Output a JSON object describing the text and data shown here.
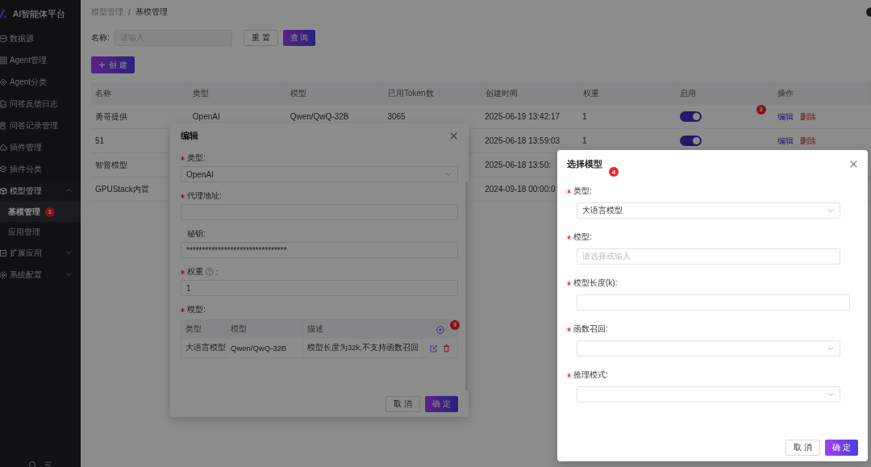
{
  "sidebar": {
    "logo": "AI智能体平台",
    "items": [
      {
        "label": "数据源"
      },
      {
        "label": "Agent管理"
      },
      {
        "label": "Agent分类"
      },
      {
        "label": "问答反馈日志"
      },
      {
        "label": "问答记录管理"
      },
      {
        "label": "插件管理"
      },
      {
        "label": "插件分类"
      },
      {
        "label": "模型管理",
        "expanded": true,
        "children": [
          {
            "label": "基模管理",
            "selected": true,
            "badge": "1"
          },
          {
            "label": "应用管理",
            "selected": false
          }
        ]
      },
      {
        "label": "扩展应用",
        "expanded": false
      },
      {
        "label": "系统配置",
        "expanded": false
      }
    ]
  },
  "breadcrumb": {
    "items": [
      "模型管理",
      "基模管理"
    ],
    "separator": "/"
  },
  "filter": {
    "label": "名称:",
    "placeholder": "请输入",
    "buttons": [
      {
        "label": "重 置",
        "kind": "default"
      },
      {
        "label": "查 询",
        "kind": "primary"
      }
    ]
  },
  "create_button": {
    "label": "创 建"
  },
  "table": {
    "columns": [
      "名称",
      "类型",
      "模型",
      "已用Token数",
      "创建时间",
      "权重",
      "启用",
      "操作"
    ],
    "rows": [
      {
        "name": "勇哥提供",
        "type": "OpenAI",
        "model": "Qwen/QwQ-32B",
        "tokens": "3065",
        "created": "2025-06-19 13:42:17",
        "weight": "1",
        "enabled": true,
        "actions": [
          "编辑",
          "删除"
        ],
        "badge": "2"
      },
      {
        "name": "51",
        "created": "2025-06-18 13:59:03",
        "weight": "1",
        "enabled": true,
        "actions": [
          "编辑",
          "删除"
        ]
      },
      {
        "name": "智普模型",
        "created": "2025-06-18 13:50:"
      },
      {
        "name": "GPUStack内置",
        "created": "2024-09-18 00:00:0"
      }
    ]
  },
  "edit_dialog": {
    "title": "编辑",
    "fields": [
      {
        "label": "类型:",
        "required": true,
        "kind": "select",
        "value": "OpenAI"
      },
      {
        "label": "代理地址:",
        "required": true,
        "kind": "input"
      },
      {
        "label": "秘钥:",
        "required": false,
        "kind": "input",
        "value": "********************************"
      },
      {
        "label": "权重",
        "suffix": ":",
        "required": true,
        "kind": "input",
        "value": "1",
        "help": true
      },
      {
        "label": "模型:",
        "required": true,
        "kind": "table",
        "columns": [
          "类型",
          "模型",
          "描述"
        ],
        "rows": [
          [
            "大语言模型",
            "Qwen/QwQ-32B",
            "模型长度为32k,不支持函数召回"
          ]
        ],
        "badge": "3"
      }
    ],
    "buttons": [
      {
        "label": "取 消",
        "kind": "default"
      },
      {
        "label": "确 定",
        "kind": "primary"
      }
    ]
  },
  "select_dialog": {
    "title": "选择模型",
    "badge": "4",
    "fields": [
      {
        "label": "类型:",
        "required": true,
        "kind": "select",
        "value": "大语言模型"
      },
      {
        "label": "模型:",
        "required": true,
        "kind": "input",
        "placeholder": "请选择或输入"
      },
      {
        "label": "模型长度(k):",
        "required": true,
        "kind": "input"
      },
      {
        "label": "函数召回:",
        "required": true,
        "kind": "select"
      },
      {
        "label": "推理模式:",
        "required": true,
        "kind": "select"
      }
    ],
    "buttons": [
      {
        "label": "取 消",
        "kind": "default"
      },
      {
        "label": "确 定",
        "kind": "primary"
      }
    ]
  }
}
